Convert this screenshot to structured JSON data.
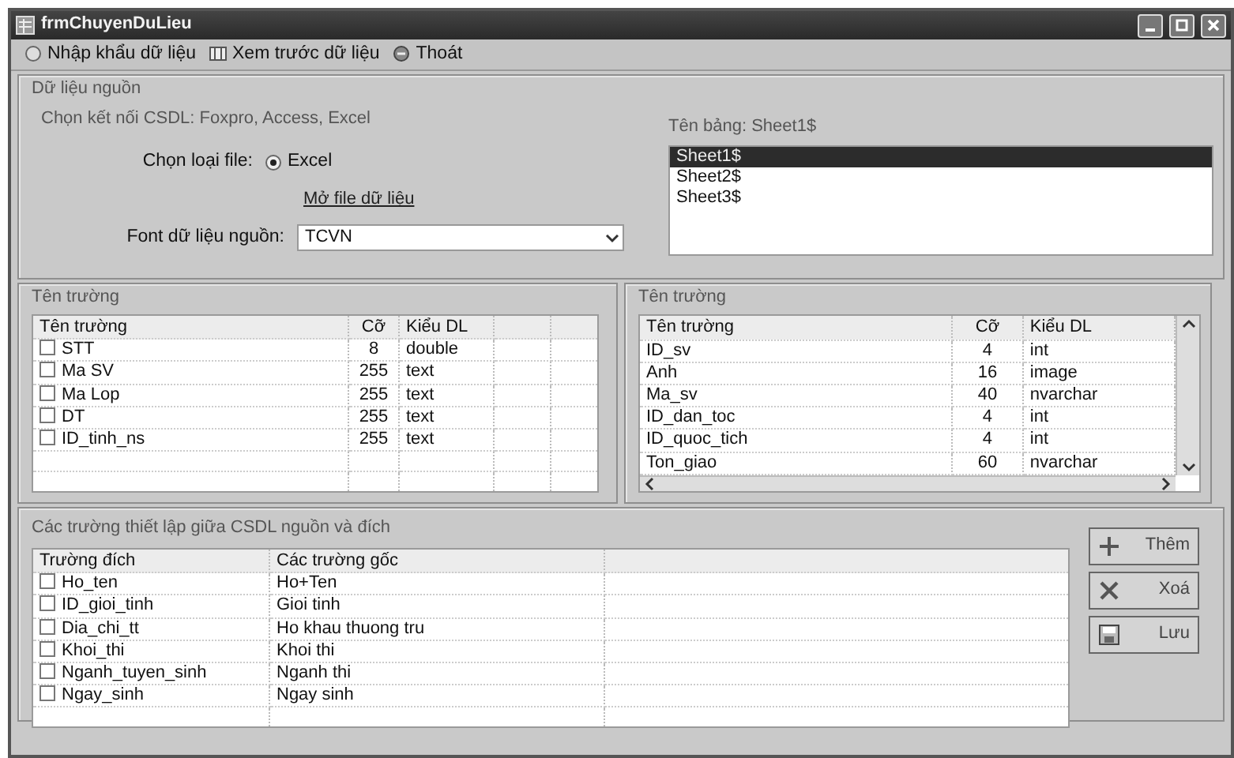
{
  "window": {
    "title": "frmChuyenDuLieu"
  },
  "toolbar": [
    {
      "label": "Nhập khẩu dữ liệu",
      "kind": "import"
    },
    {
      "label": "Xem trước dữ liệu",
      "kind": "preview"
    },
    {
      "label": "Thoát",
      "kind": "exit"
    }
  ],
  "source_group": {
    "title": "Dữ liệu nguồn",
    "connect_label": "Chọn kết nối CSDL: Foxpro, Access, Excel",
    "file_type_label": "Chọn loại file:",
    "file_type_option": {
      "label": "Excel",
      "selected": true
    },
    "open_link": "Mở file dữ liệu",
    "font_label": "Font dữ liệu nguồn:",
    "font_value": "TCVN"
  },
  "tables_panel": {
    "label": "Tên bảng: Sheet1$",
    "items": [
      {
        "label": "Sheet1$",
        "selected": true
      },
      {
        "label": "Sheet2$",
        "selected": false
      },
      {
        "label": "Sheet3$",
        "selected": false
      }
    ]
  },
  "source_fields": {
    "title": "Tên trường",
    "columns": [
      "Tên trường",
      "Cỡ",
      "Kiểu DL"
    ],
    "rows": [
      {
        "checked": false,
        "cells": [
          "STT",
          "8",
          "double"
        ]
      },
      {
        "checked": false,
        "cells": [
          "Ma SV",
          "255",
          "text"
        ]
      },
      {
        "checked": false,
        "cells": [
          "Ma Lop",
          "255",
          "text"
        ]
      },
      {
        "checked": false,
        "cells": [
          "DT",
          "255",
          "text"
        ]
      },
      {
        "checked": false,
        "cells": [
          "ID_tinh_ns",
          "255",
          "text"
        ]
      }
    ]
  },
  "dest_fields": {
    "title": "Tên trường",
    "columns": [
      "Tên trường",
      "Cỡ",
      "Kiểu DL"
    ],
    "rows": [
      {
        "cells": [
          "ID_sv",
          "4",
          "int"
        ]
      },
      {
        "cells": [
          "Anh",
          "16",
          "image"
        ]
      },
      {
        "cells": [
          "Ma_sv",
          "40",
          "nvarchar"
        ]
      },
      {
        "cells": [
          "ID_dan_toc",
          "4",
          "int"
        ]
      },
      {
        "cells": [
          "ID_quoc_tich",
          "4",
          "int"
        ]
      },
      {
        "cells": [
          "Ton_giao",
          "60",
          "nvarchar"
        ]
      }
    ]
  },
  "mapping": {
    "title": "Các trường thiết lập giữa CSDL nguồn và đích",
    "columns": [
      "Trường đích",
      "Các trường gốc"
    ],
    "rows": [
      {
        "checked": false,
        "cells": [
          "Ho_ten",
          "Ho+Ten"
        ]
      },
      {
        "checked": false,
        "cells": [
          "ID_gioi_tinh",
          "Gioi tinh"
        ]
      },
      {
        "checked": false,
        "cells": [
          "Dia_chi_tt",
          "Ho khau thuong tru"
        ]
      },
      {
        "checked": false,
        "cells": [
          "Khoi_thi",
          "Khoi thi"
        ]
      },
      {
        "checked": false,
        "cells": [
          "Nganh_tuyen_sinh",
          "Nganh thi"
        ]
      },
      {
        "checked": false,
        "cells": [
          "Ngay_sinh",
          "Ngay sinh"
        ]
      }
    ]
  },
  "buttons": [
    {
      "label": "Thêm",
      "kind": "add"
    },
    {
      "label": "Xoá",
      "kind": "delete"
    },
    {
      "label": "Lưu",
      "kind": "save"
    }
  ]
}
